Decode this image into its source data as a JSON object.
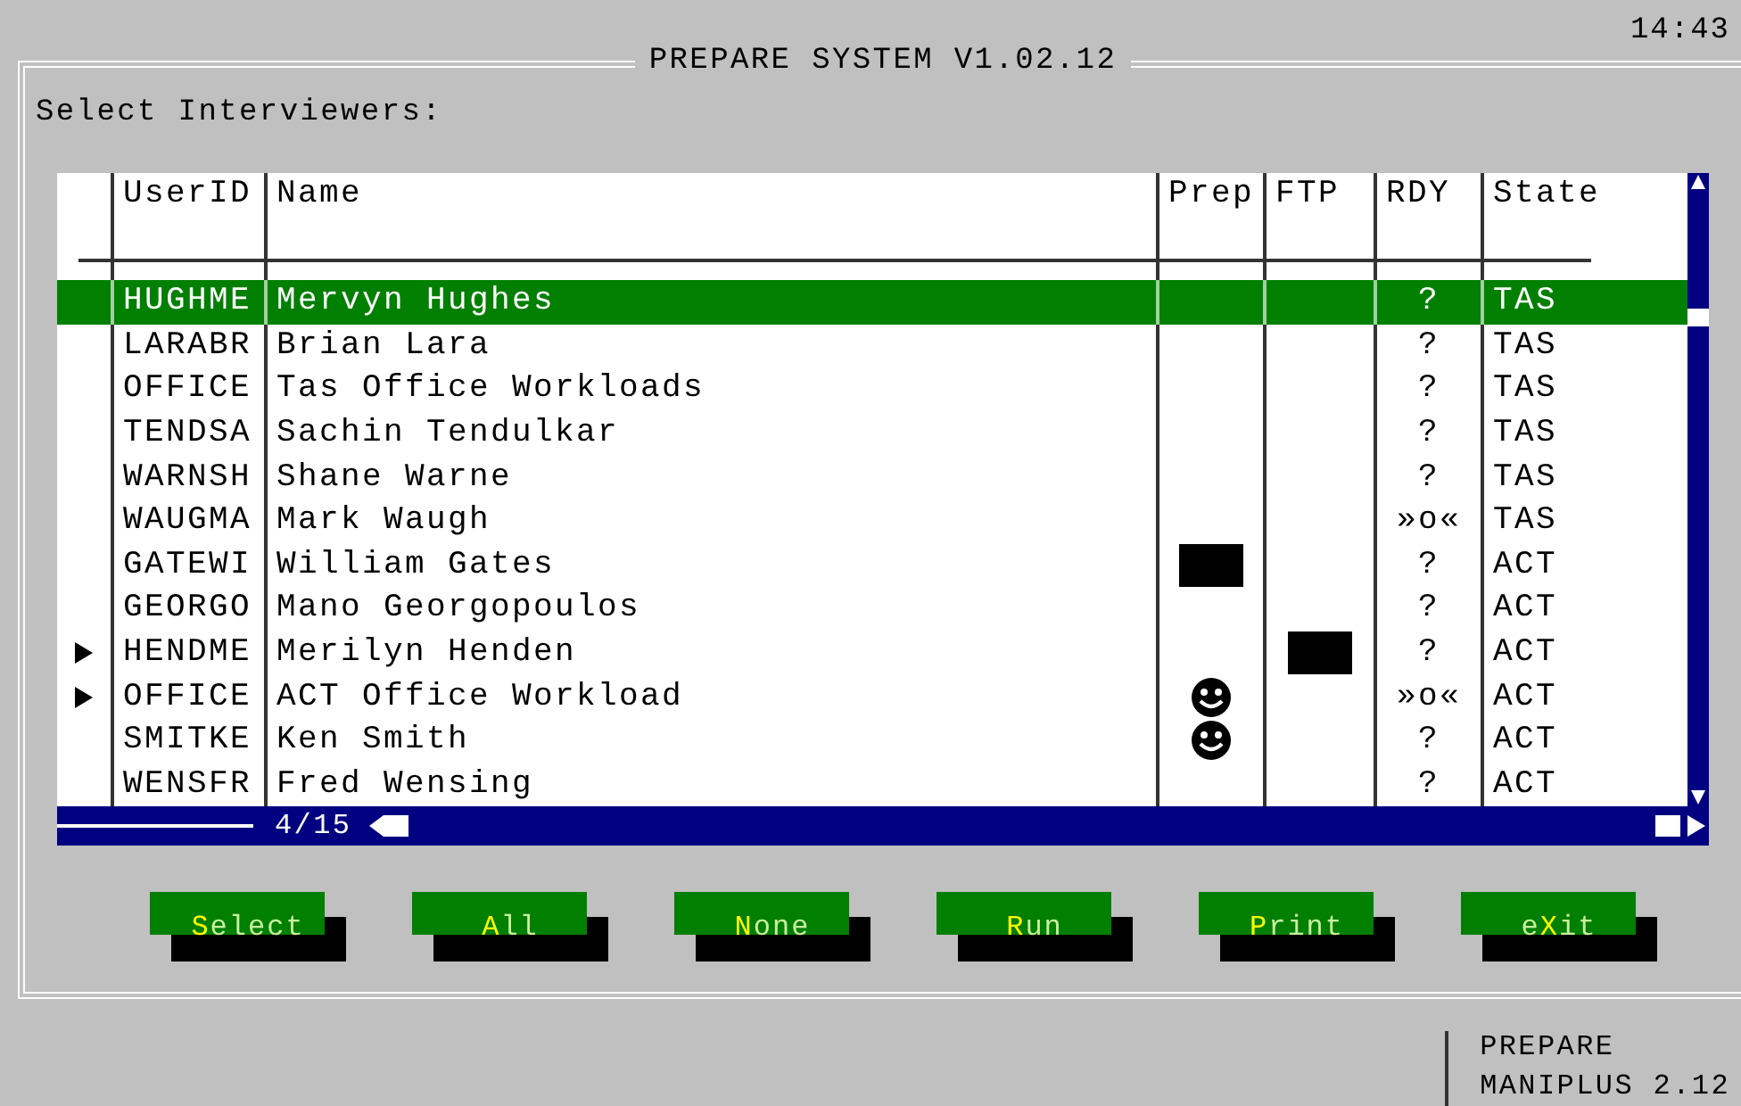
{
  "clock": "14:43",
  "window": {
    "title": "PREPARE SYSTEM V1.02.12"
  },
  "prompt": "Select Interviewers:",
  "table": {
    "columns": [
      "UserID",
      "Name",
      "Prep",
      "FTP",
      "RDY",
      "State"
    ],
    "rows": [
      {
        "marked": false,
        "selected": true,
        "user_id": "HUGHME",
        "name": "Mervyn Hughes",
        "rdy": "?",
        "state": "TAS"
      },
      {
        "marked": false,
        "selected": false,
        "user_id": "LARABR",
        "name": "Brian Lara",
        "rdy": "?",
        "state": "TAS"
      },
      {
        "marked": false,
        "selected": false,
        "user_id": "OFFICE",
        "name": "Tas Office Workloads",
        "rdy": "?",
        "state": "TAS"
      },
      {
        "marked": false,
        "selected": false,
        "user_id": "TENDSA",
        "name": "Sachin Tendulkar",
        "rdy": "?",
        "state": "TAS"
      },
      {
        "marked": false,
        "selected": false,
        "user_id": "WARNSH",
        "name": "Shane Warne",
        "rdy": "?",
        "state": "TAS"
      },
      {
        "marked": false,
        "selected": false,
        "user_id": "WAUGMA",
        "name": "Mark Waugh",
        "rdy": "»o«",
        "state": "TAS"
      },
      {
        "marked": false,
        "selected": false,
        "user_id": "GATEWI",
        "name": "William Gates",
        "prep": {
          "kind": "block"
        },
        "rdy": "?",
        "state": "ACT"
      },
      {
        "marked": false,
        "selected": false,
        "user_id": "GEORGO",
        "name": "Mano Georgopoulos",
        "rdy": "?",
        "state": "ACT"
      },
      {
        "marked": true,
        "selected": false,
        "user_id": "HENDME",
        "name": "Merilyn Henden",
        "ftp": {
          "kind": "block"
        },
        "rdy": "?",
        "state": "ACT"
      },
      {
        "marked": true,
        "selected": false,
        "user_id": "OFFICE",
        "name": "ACT Office Workload",
        "prep": {
          "kind": "smiley"
        },
        "rdy": "»o«",
        "state": "ACT"
      },
      {
        "marked": false,
        "selected": false,
        "user_id": "SMITKE",
        "name": "Ken Smith",
        "prep": {
          "kind": "smiley"
        },
        "rdy": "?",
        "state": "ACT"
      },
      {
        "marked": false,
        "selected": false,
        "user_id": "WENSFR",
        "name": "Fred Wensing",
        "rdy": "?",
        "state": "ACT"
      }
    ],
    "position": "4/15"
  },
  "buttons": [
    {
      "hotkey": "S",
      "rest": "elect"
    },
    {
      "hotkey": "A",
      "rest": "ll"
    },
    {
      "hotkey": "N",
      "rest": "one"
    },
    {
      "hotkey": "R",
      "rest": "un"
    },
    {
      "hotkey": "P",
      "rest": "rint"
    },
    {
      "prefix": "e",
      "hotkey": "X",
      "rest": "it"
    }
  ],
  "status_bar": {
    "lines": [
      "PREPARE",
      "MANIPLUS 2.12"
    ]
  }
}
